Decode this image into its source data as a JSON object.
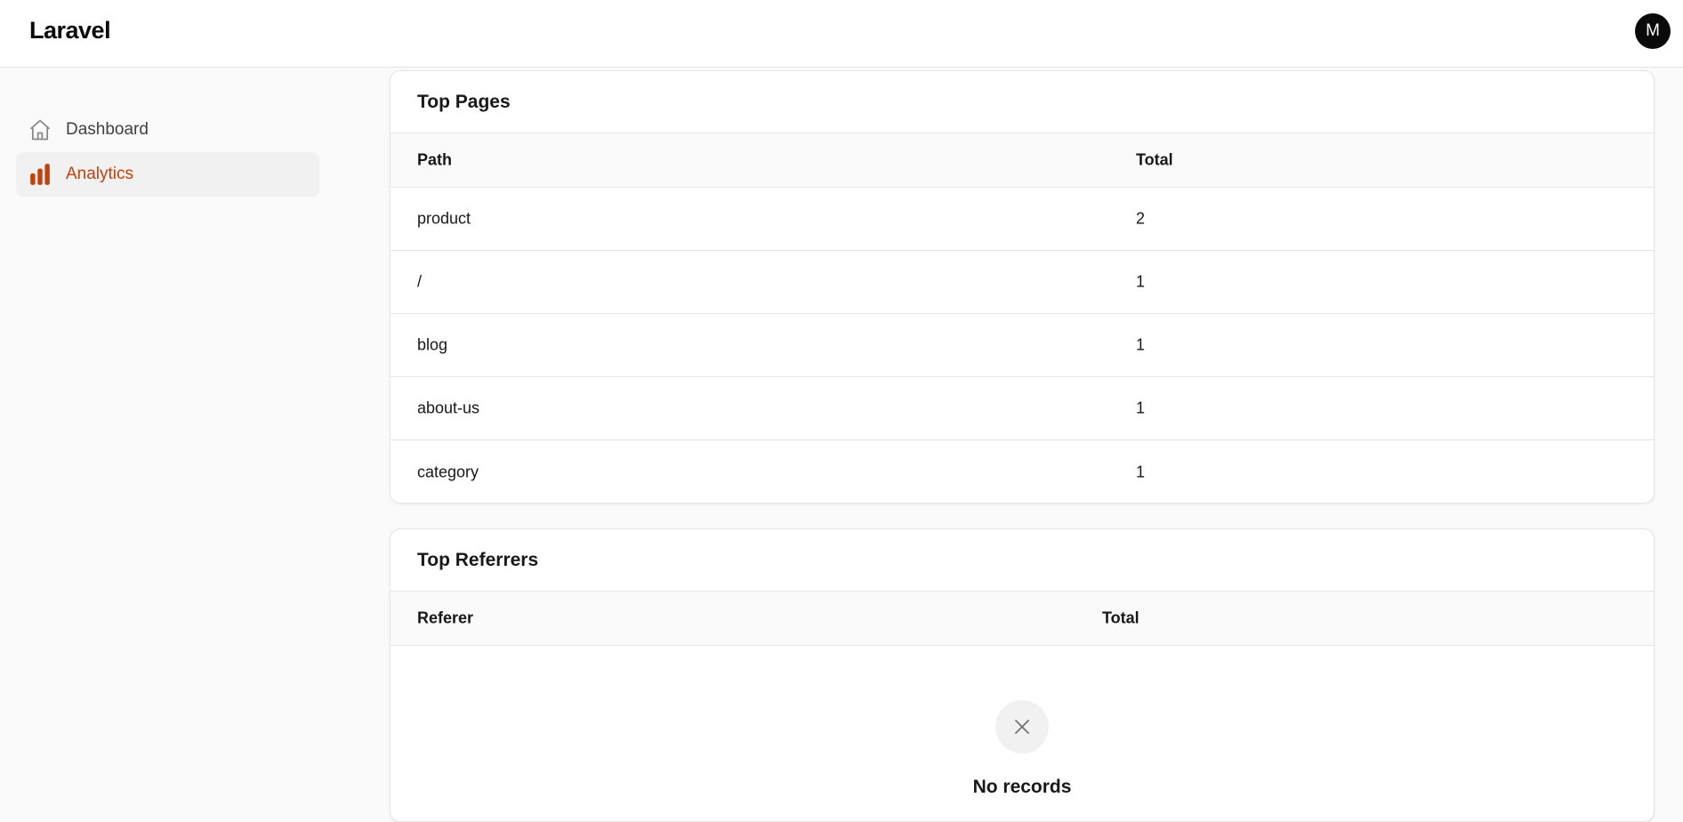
{
  "app": {
    "brand": "Laravel",
    "avatar_initial": "M"
  },
  "sidebar": {
    "items": [
      {
        "label": "Dashboard",
        "icon": "home-icon",
        "active": false
      },
      {
        "label": "Analytics",
        "icon": "bar-chart-icon",
        "active": true
      }
    ]
  },
  "colors": {
    "accent": "#c2410c",
    "avatar_bg": "#0a0a0a"
  },
  "top_pages": {
    "title": "Top Pages",
    "columns": [
      "Path",
      "Total"
    ],
    "rows": [
      {
        "path": "product",
        "total": "2"
      },
      {
        "path": "/",
        "total": "1"
      },
      {
        "path": "blog",
        "total": "1"
      },
      {
        "path": "about-us",
        "total": "1"
      },
      {
        "path": "category",
        "total": "1"
      }
    ]
  },
  "top_referrers": {
    "title": "Top Referrers",
    "columns": [
      "Referer",
      "Total"
    ],
    "empty_text": "No records",
    "empty_icon": "close-icon"
  }
}
